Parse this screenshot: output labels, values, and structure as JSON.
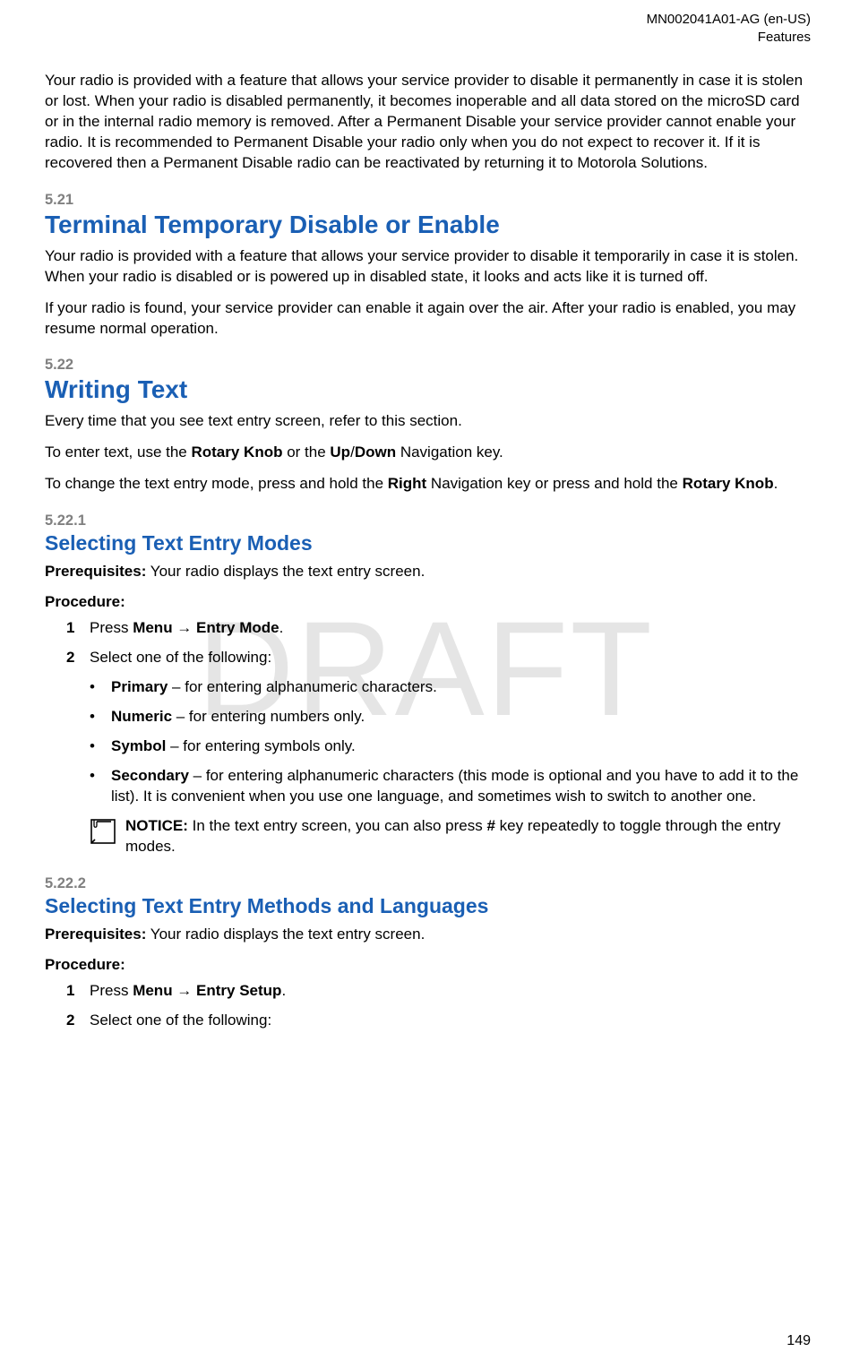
{
  "header": {
    "doc_id": "MN002041A01-AG (en-US)",
    "chapter": "Features"
  },
  "watermark": "DRAFT",
  "intro_paragraph": "Your radio is provided with a feature that allows your service provider to disable it permanently in case it is stolen or lost. When your radio is disabled permanently, it becomes inoperable and all data stored on the microSD card or in the internal radio memory is removed. After a Permanent Disable your service provider cannot enable your radio. It is recommended to Permanent Disable your radio only when you do not expect to recover it. If it is recovered then a Permanent Disable radio can be reactivated by returning it to Motorola Solutions.",
  "sections": {
    "s521": {
      "num": "5.21",
      "title": "Terminal Temporary Disable or Enable",
      "para1": "Your radio is provided with a feature that allows your service provider to disable it temporarily in case it is stolen. When your radio is disabled or is powered up in disabled state, it looks and acts like it is turned off.",
      "para2": "If your radio is found, your service provider can enable it again over the air. After your radio is enabled, you may resume normal operation."
    },
    "s522": {
      "num": "5.22",
      "title": "Writing Text",
      "para1": "Every time that you see text entry screen, refer to this section.",
      "para2_pre": "To enter text, use the ",
      "para2_b1": "Rotary Knob",
      "para2_mid": " or the ",
      "para2_b2": "Up",
      "para2_slash": "/",
      "para2_b3": "Down",
      "para2_post": " Navigation key.",
      "para3_pre": "To change the text entry mode, press and hold the ",
      "para3_b1": "Right",
      "para3_mid": " Navigation key or press and hold the ",
      "para3_b2": "Rotary Knob",
      "para3_post": "."
    },
    "s5221": {
      "num": "5.22.1",
      "title": "Selecting Text Entry Modes",
      "prereq_label": "Prerequisites:",
      "prereq_text": " Your radio displays the text entry screen.",
      "procedure_label": "Procedure:",
      "step1_num": "1",
      "step1_pre": "Press ",
      "step1_b1": "Menu",
      "step1_arrow": " → ",
      "step1_b2": "Entry Mode",
      "step1_post": ".",
      "step2_num": "2",
      "step2_text": "Select one of the following:",
      "bullets": [
        {
          "b": "Primary",
          "t": " – for entering alphanumeric characters."
        },
        {
          "b": "Numeric",
          "t": " – for entering numbers only."
        },
        {
          "b": "Symbol",
          "t": " – for entering symbols only."
        },
        {
          "b": "Secondary",
          "t": " – for entering alphanumeric characters (this mode is optional and you have to add it to the list). It is convenient when you use one language, and sometimes wish to switch to another one."
        }
      ],
      "notice_label": "NOTICE:",
      "notice_pre": " In the text entry screen, you can also press ",
      "notice_b": "#",
      "notice_post": " key repeatedly to toggle through the entry modes."
    },
    "s5222": {
      "num": "5.22.2",
      "title": "Selecting Text Entry Methods and Languages",
      "prereq_label": "Prerequisites:",
      "prereq_text": " Your radio displays the text entry screen.",
      "procedure_label": "Procedure:",
      "step1_num": "1",
      "step1_pre": "Press ",
      "step1_b1": "Menu",
      "step1_arrow": " → ",
      "step1_b2": "Entry Setup",
      "step1_post": ".",
      "step2_num": "2",
      "step2_text": "Select one of the following:"
    }
  },
  "page_number": "149"
}
